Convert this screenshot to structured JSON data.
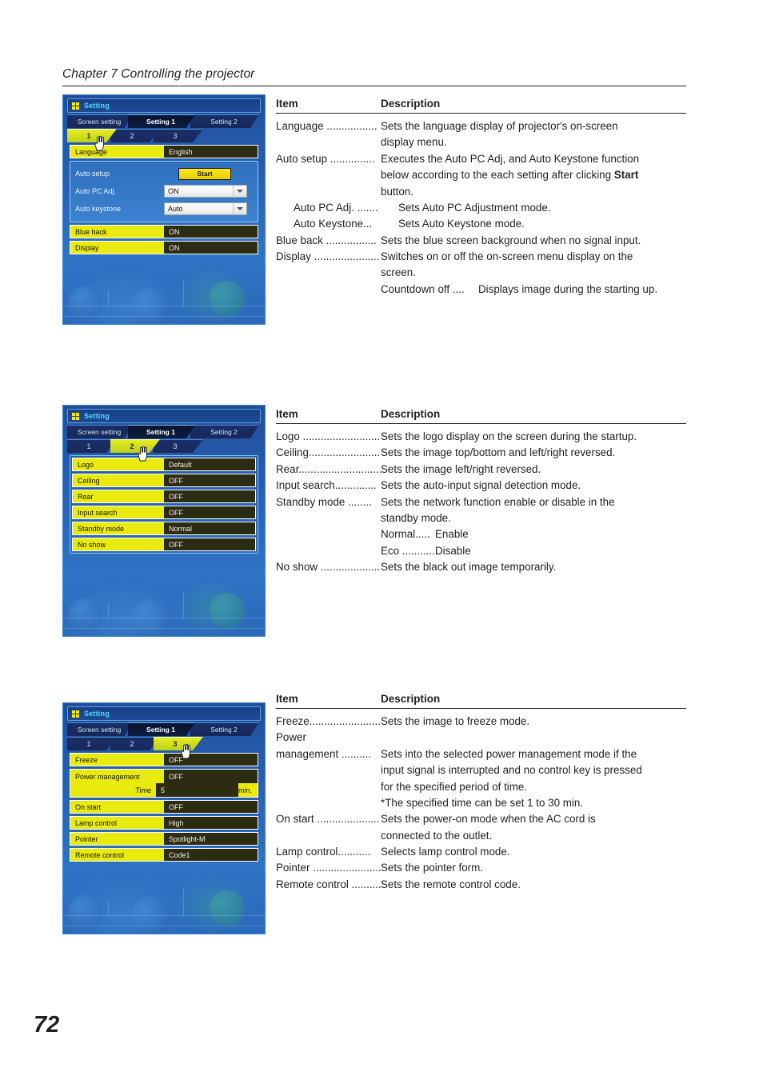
{
  "header": {
    "chapter": "Chapter 7 Controlling the projector"
  },
  "page": {
    "number": "72"
  },
  "sections": [
    {
      "osd": {
        "title": "Setting",
        "main_tabs": [
          {
            "label": "Screen setting",
            "active": false
          },
          {
            "label": "Setting 1",
            "active": true
          },
          {
            "label": "Setting 2",
            "active": false
          }
        ],
        "sub_tabs": [
          {
            "label": "1",
            "active": true
          },
          {
            "label": "2",
            "active": false
          },
          {
            "label": "3",
            "active": false
          }
        ],
        "rows_top": [
          {
            "label": "Language",
            "value": "English"
          }
        ],
        "blue_group": {
          "auto_setup_label": "Auto setup",
          "start_button": "Start",
          "auto_pc_label": "Auto PC Adj.",
          "auto_pc_value": "ON",
          "auto_keystone_label": "Auto keystone",
          "auto_keystone_value": "Auto"
        },
        "rows_bottom": [
          {
            "label": "Blue back",
            "value": "ON"
          },
          {
            "label": "Display",
            "value": "ON"
          }
        ]
      },
      "table": {
        "head_item": "Item",
        "head_desc": "Description",
        "rows": [
          {
            "item": "Language .................",
            "text": "Sets the language display of projector's on-screen",
            "cont": [
              "display menu."
            ]
          },
          {
            "item": "Auto setup ...............",
            "text_pre": "Executes the Auto PC Adj, and Auto Keystone function",
            "cont": [
              "below according to the each setting after clicking ",
              "button."
            ],
            "bold_word": "Start"
          },
          {
            "item": "Auto PC Adj. .......",
            "text": "Sets Auto PC Adjustment mode.",
            "indent": true
          },
          {
            "item": "Auto Keystone...",
            "text": "Sets Auto Keystone mode.",
            "indent": true
          },
          {
            "item": "Blue back .................",
            "text": "Sets the blue screen background  when no signal input."
          },
          {
            "item": "Display ......................",
            "text": "Switches on or off the on-screen menu display on the",
            "cont": [
              "screen."
            ]
          }
        ],
        "sub_rows": [
          {
            "name": "Countdown off ....",
            "text": "Displays image during the starting up."
          }
        ]
      }
    },
    {
      "osd": {
        "title": "Setting",
        "main_tabs": [
          {
            "label": "Screen setting",
            "active": false
          },
          {
            "label": "Setting 1",
            "active": true
          },
          {
            "label": "Setting 2",
            "active": false
          }
        ],
        "sub_tabs": [
          {
            "label": "1",
            "active": false
          },
          {
            "label": "2",
            "active": true
          },
          {
            "label": "3",
            "active": false
          }
        ],
        "rows": [
          {
            "label": "Logo",
            "value": "Default"
          },
          {
            "label": "Ceiling",
            "value": "OFF"
          },
          {
            "label": "Rear",
            "value": "OFF"
          },
          {
            "label": "Input search",
            "value": "OFF"
          },
          {
            "label": "Standby mode",
            "value": "Normal"
          },
          {
            "label": "No show",
            "value": "OFF"
          }
        ]
      },
      "table": {
        "head_item": "Item",
        "head_desc": "Description",
        "rows": [
          {
            "item": "Logo ...........................",
            "text": "Sets the logo display on the screen during the startup."
          },
          {
            "item": "Ceiling........................",
            "text": "Sets the image top/bottom and left/right reversed."
          },
          {
            "item": "Rear............................",
            "text": "Sets the image left/right reversed."
          },
          {
            "item": "Input search..............",
            "text": "Sets the auto-input signal detection mode."
          },
          {
            "item": "Standby mode ........",
            "text": "Sets the network function enable or disable in the",
            "cont": [
              "standby mode."
            ]
          }
        ],
        "sub_rows": [
          {
            "name": "Normal.....",
            "text": "Enable"
          },
          {
            "name": "Eco ............",
            "text": "Disable"
          }
        ],
        "rows_after": [
          {
            "item": "No show ....................",
            "text": "Sets the black out image temporarily."
          }
        ]
      }
    },
    {
      "osd": {
        "title": "Setting",
        "main_tabs": [
          {
            "label": "Screen setting",
            "active": false
          },
          {
            "label": "Setting 1",
            "active": true
          },
          {
            "label": "Setting 2",
            "active": false
          }
        ],
        "sub_tabs": [
          {
            "label": "1",
            "active": false
          },
          {
            "label": "2",
            "active": false
          },
          {
            "label": "3",
            "active": true
          }
        ],
        "rows_a": [
          {
            "label": "Freeze",
            "value": "OFF"
          }
        ],
        "power_row": {
          "label": "Power management",
          "value": "OFF",
          "time_label": "Time",
          "time_value": "5",
          "time_unit": "min."
        },
        "rows_b": [
          {
            "label": "On start",
            "value": "OFF"
          },
          {
            "label": "Lamp control",
            "value": "High"
          },
          {
            "label": "Pointer",
            "value": "Spotlight-M"
          },
          {
            "label": "Remote control",
            "value": "Code1"
          }
        ]
      },
      "table": {
        "head_item": "Item",
        "head_desc": "Description",
        "rows": [
          {
            "item": "Freeze..........................",
            "text": "Sets the image to freeze mode."
          },
          {
            "item": "Power",
            "text": ""
          },
          {
            "item": "management ..........",
            "text": "Sets into the selected power management mode if the",
            "cont": [
              "input signal is interrupted and no control key is pressed",
              "for the specified period of time.",
              "*The specified time can be set 1 to 30 min."
            ]
          },
          {
            "item": "On start .....................",
            "text": "Sets the power-on mode when the AC cord  is",
            "cont": [
              "connected to the outlet."
            ]
          },
          {
            "item": "Lamp control...........",
            "text": "Selects lamp control mode."
          },
          {
            "item": "Pointer .......................",
            "text": "Sets the pointer form."
          },
          {
            "item": "Remote control ..........",
            "text": "Sets the remote control code."
          }
        ]
      }
    }
  ]
}
